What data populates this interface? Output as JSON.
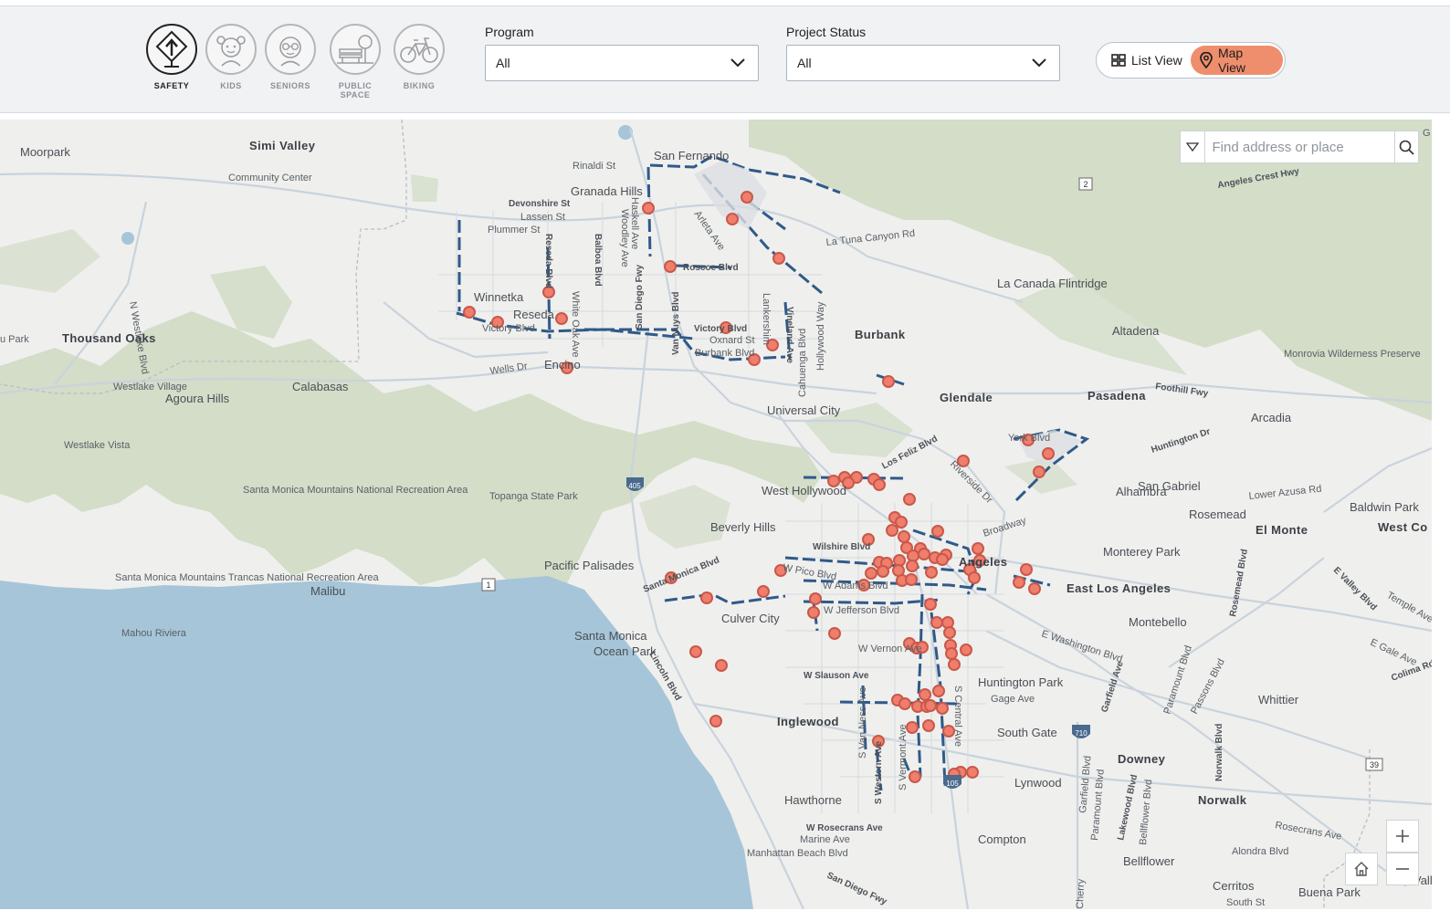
{
  "categories": [
    {
      "label": "SAFETY",
      "icon": "safety-sign-icon",
      "active": true
    },
    {
      "label": "KIDS",
      "icon": "kids-icon",
      "active": false
    },
    {
      "label": "SENIORS",
      "icon": "seniors-icon",
      "active": false
    },
    {
      "label": "PUBLIC SPACE",
      "icon": "public-space-icon",
      "active": false
    },
    {
      "label": "BIKING",
      "icon": "bicycle-icon",
      "active": false
    }
  ],
  "filters": {
    "program": {
      "label": "Program",
      "value": "All"
    },
    "status": {
      "label": "Project Status",
      "value": "All"
    }
  },
  "view_toggle": {
    "list_label": "List View",
    "map_label": "Map View",
    "active": "map"
  },
  "search": {
    "placeholder": "Find address or place"
  },
  "colors": {
    "accent": "#ef8e6d",
    "marker": "#ef7f6c",
    "route": "#2f5a8a",
    "water": "#a6c5d8",
    "parks": "#d3ddc8"
  },
  "map_labels": {
    "simi_valley": "Simi Valley",
    "moorpark": "Moorpark",
    "community_center": "Community Center",
    "san_fernando": "San Fernando",
    "rinaldi": "Rinaldi St",
    "granada_hills": "Granada Hills",
    "devonshire": "Devonshire St",
    "lassen": "Lassen St",
    "plummer": "Plummer St",
    "reseda_blvd": "Reseda Blvd",
    "balboa": "Balboa Blvd",
    "woodley": "Woodley Ave",
    "haskell": "Haskell Ave",
    "san_diego_fwy": "San Diego Fwy",
    "van_nuys": "Van Nuys Blvd",
    "arleta": "Arleta Ave",
    "roscoe": "Roscoe Blvd",
    "la_tuna": "La Tuna Canyon Rd",
    "winnetka": "Winnetka",
    "reseda": "Reseda",
    "victory_w": "Victory Blvd",
    "white_oak": "White Oak Ave",
    "victory": "Victory Blvd",
    "oxnard": "Oxnard St",
    "burbank_blvd": "Burbank Blvd",
    "lankershim": "Lankershim",
    "vineland": "Vineland Ave",
    "cahuenga": "Cahuenga Blvd",
    "hollywood_way": "Hollywood Way",
    "burbank": "Burbank",
    "la_canada": "La Canada Flintridge",
    "altadena": "Altadena",
    "monrovia": "Monrovia Wilderness Preserve",
    "angeles_crest": "Angeles Crest Hwy",
    "thousand_oaks": "Thousand Oaks",
    "u_park": "u Park",
    "n_westlake": "N Westlake Blvd",
    "encino": "Encino",
    "wells": "Wells Dr",
    "westlake_village": "Westlake Village",
    "agoura_hills": "Agoura Hills",
    "calabasas": "Calabasas",
    "universal_city": "Universal City",
    "glendale": "Glendale",
    "pasadena": "Pasadena",
    "foothill": "Foothill Fwy",
    "arcadia": "Arcadia",
    "huntington_dr": "Huntington Dr",
    "westlake_vista": "Westlake Vista",
    "topanga": "Topanga State Park",
    "smm_nra": "Santa Monica Mountains National Recreation Area",
    "los_feliz": "Los Feliz Blvd",
    "riverside": "Riverside Dr",
    "york": "York Blvd",
    "west_hollywood": "West Hollywood",
    "san_gabriel": "San Gabriel",
    "alhambra": "Alhambra",
    "rosemead": "Rosemead",
    "baldwin_park": "Baldwin Park",
    "el_monte": "El Monte",
    "west_co": "West Co",
    "lower_azusa": "Lower Azusa Rd",
    "beverly_hills": "Beverly Hills",
    "wilshire": "Wilshire Blvd",
    "broadway": "Broadway",
    "angeles": "Angeles",
    "monterey_park": "Monterey Park",
    "rosemead_blvd": "Rosemead Blvd",
    "e_valley": "E Valley Blvd",
    "temple": "Temple Ave",
    "pacific_palisades": "Pacific Palisades",
    "smm_nra2": "Santa Monica Mountains Trancas National Recreation Area",
    "malibu": "Malibu",
    "mahou": "Mahou Riviera",
    "santa_monica_blvd": "Santa Monica Blvd",
    "w_pico": "W Pico Blvd",
    "w_adams": "W Adams Blvd",
    "w_jefferson": "W Jefferson Blvd",
    "east_la": "East Los Angeles",
    "montebello": "Montebello",
    "e_washington": "E Washington Blvd",
    "e_gale": "E Gale Ave",
    "colima": "Colima Rd",
    "culver_city": "Culver City",
    "santa_monica": "Santa Monica",
    "ocean_park": "Ocean Park",
    "lincoln": "Lincoln Blvd",
    "w_vernon": "W Vernon Ave",
    "w_slauson": "W Slauson Ave",
    "huntington_park": "Huntington Park",
    "gage": "Gage Ave",
    "garfield": "Garfield Ave",
    "paramount": "Paramount Blvd",
    "passons": "Passons Blvd",
    "whittier": "Whittier",
    "inglewood": "Inglewood",
    "south_gate": "South Gate",
    "downey": "Downey",
    "s_central": "S Central Ave",
    "s_vermont": "S Vermont Ave",
    "s_western": "S Western Ave",
    "s_van_ness": "S Van Ness Ave",
    "hawthorne": "Hawthorne",
    "lynwood": "Lynwood",
    "norwalk": "Norwalk",
    "norwalk_blvd": "Norwalk Blvd",
    "w_rosecrans": "W Rosecrans Ave",
    "rosecrans_e": "Rosecrans Ave",
    "marine": "Marine Ave",
    "manhattan": "Manhattan Beach Blvd",
    "compton": "Compton",
    "alondra": "Alondra Blvd",
    "bellflower": "Bellflower",
    "bellflower_blvd": "Bellflower Blvd",
    "lakewood": "Lakewood Blvd",
    "garfield_s": "Garfield Blvd",
    "paramount_s": "Paramount Blvd",
    "cerritos": "Cerritos",
    "buena_park": "Buena Park",
    "south_st": "South St",
    "san_diego_fwy_s": "San Diego Fwy",
    "cherry": "Cherry",
    "alle": "Valle",
    "shield_405": "405",
    "shield_1": "1",
    "shield_2": "2",
    "shield_710": "710",
    "shield_105": "105",
    "shield_39": "39",
    "edge_g": "G"
  }
}
